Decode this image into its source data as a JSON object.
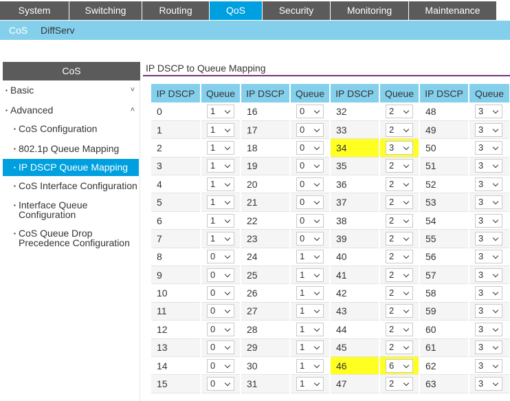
{
  "nav": {
    "tabs": [
      {
        "label": "System",
        "active": false
      },
      {
        "label": "Switching",
        "active": false
      },
      {
        "label": "Routing",
        "active": false
      },
      {
        "label": "QoS",
        "active": true
      },
      {
        "label": "Security",
        "active": false
      },
      {
        "label": "Monitoring",
        "active": false
      },
      {
        "label": "Maintenance",
        "active": false
      }
    ],
    "subtabs": [
      {
        "label": "CoS",
        "active": true
      },
      {
        "label": "DiffServ",
        "active": false
      }
    ]
  },
  "sidebar": {
    "header": "CoS",
    "items": [
      {
        "label": "Basic",
        "level": 0,
        "chevron": "chevron-down-icon",
        "active": false
      },
      {
        "label": "Advanced",
        "level": 0,
        "chevron": "chevron-up-icon",
        "active": false
      },
      {
        "label": "CoS Configuration",
        "level": 1,
        "active": false
      },
      {
        "label": "802.1p Queue Mapping",
        "level": 1,
        "active": false
      },
      {
        "label": "IP DSCP Queue Mapping",
        "level": 1,
        "active": true
      },
      {
        "label": "CoS Interface Configuration",
        "level": 1,
        "active": false
      },
      {
        "label": "Interface Queue Configuration",
        "level": 1,
        "active": false
      },
      {
        "label": "CoS Queue Drop Precedence Configuration",
        "level": 1,
        "active": false
      }
    ]
  },
  "main": {
    "title": "IP DSCP to Queue Mapping",
    "columns": [
      "IP DSCP",
      "Queue",
      "IP DSCP",
      "Queue",
      "IP DSCP",
      "Queue",
      "IP DSCP",
      "Queue"
    ],
    "rows": [
      [
        {
          "dscp": "0",
          "queue": "1"
        },
        {
          "dscp": "16",
          "queue": "0"
        },
        {
          "dscp": "32",
          "queue": "2"
        },
        {
          "dscp": "48",
          "queue": "3"
        }
      ],
      [
        {
          "dscp": "1",
          "queue": "1"
        },
        {
          "dscp": "17",
          "queue": "0"
        },
        {
          "dscp": "33",
          "queue": "2"
        },
        {
          "dscp": "49",
          "queue": "3"
        }
      ],
      [
        {
          "dscp": "2",
          "queue": "1"
        },
        {
          "dscp": "18",
          "queue": "0"
        },
        {
          "dscp": "34",
          "queue": "3",
          "highlight": true
        },
        {
          "dscp": "50",
          "queue": "3"
        }
      ],
      [
        {
          "dscp": "3",
          "queue": "1"
        },
        {
          "dscp": "19",
          "queue": "0"
        },
        {
          "dscp": "35",
          "queue": "2"
        },
        {
          "dscp": "51",
          "queue": "3"
        }
      ],
      [
        {
          "dscp": "4",
          "queue": "1"
        },
        {
          "dscp": "20",
          "queue": "0"
        },
        {
          "dscp": "36",
          "queue": "2"
        },
        {
          "dscp": "52",
          "queue": "3"
        }
      ],
      [
        {
          "dscp": "5",
          "queue": "1"
        },
        {
          "dscp": "21",
          "queue": "0"
        },
        {
          "dscp": "37",
          "queue": "2"
        },
        {
          "dscp": "53",
          "queue": "3"
        }
      ],
      [
        {
          "dscp": "6",
          "queue": "1"
        },
        {
          "dscp": "22",
          "queue": "0"
        },
        {
          "dscp": "38",
          "queue": "2"
        },
        {
          "dscp": "54",
          "queue": "3"
        }
      ],
      [
        {
          "dscp": "7",
          "queue": "1"
        },
        {
          "dscp": "23",
          "queue": "0"
        },
        {
          "dscp": "39",
          "queue": "2"
        },
        {
          "dscp": "55",
          "queue": "3"
        }
      ],
      [
        {
          "dscp": "8",
          "queue": "0"
        },
        {
          "dscp": "24",
          "queue": "1"
        },
        {
          "dscp": "40",
          "queue": "2"
        },
        {
          "dscp": "56",
          "queue": "3"
        }
      ],
      [
        {
          "dscp": "9",
          "queue": "0"
        },
        {
          "dscp": "25",
          "queue": "1"
        },
        {
          "dscp": "41",
          "queue": "2"
        },
        {
          "dscp": "57",
          "queue": "3"
        }
      ],
      [
        {
          "dscp": "10",
          "queue": "0"
        },
        {
          "dscp": "26",
          "queue": "1"
        },
        {
          "dscp": "42",
          "queue": "2"
        },
        {
          "dscp": "58",
          "queue": "3"
        }
      ],
      [
        {
          "dscp": "11",
          "queue": "0"
        },
        {
          "dscp": "27",
          "queue": "1"
        },
        {
          "dscp": "43",
          "queue": "2"
        },
        {
          "dscp": "59",
          "queue": "3"
        }
      ],
      [
        {
          "dscp": "12",
          "queue": "0"
        },
        {
          "dscp": "28",
          "queue": "1"
        },
        {
          "dscp": "44",
          "queue": "2"
        },
        {
          "dscp": "60",
          "queue": "3"
        }
      ],
      [
        {
          "dscp": "13",
          "queue": "0"
        },
        {
          "dscp": "29",
          "queue": "1"
        },
        {
          "dscp": "45",
          "queue": "2"
        },
        {
          "dscp": "61",
          "queue": "3"
        }
      ],
      [
        {
          "dscp": "14",
          "queue": "0"
        },
        {
          "dscp": "30",
          "queue": "1"
        },
        {
          "dscp": "46",
          "queue": "6",
          "highlight": true
        },
        {
          "dscp": "62",
          "queue": "3"
        }
      ],
      [
        {
          "dscp": "15",
          "queue": "0"
        },
        {
          "dscp": "31",
          "queue": "1"
        },
        {
          "dscp": "47",
          "queue": "2"
        },
        {
          "dscp": "63",
          "queue": "3"
        }
      ]
    ]
  },
  "colors": {
    "nav_bg": "#5b5b5b",
    "accent": "#00a0e0",
    "subnav_bg": "#84d0ec",
    "title_rule": "#7a2e7a",
    "highlight": "#ffff22"
  }
}
